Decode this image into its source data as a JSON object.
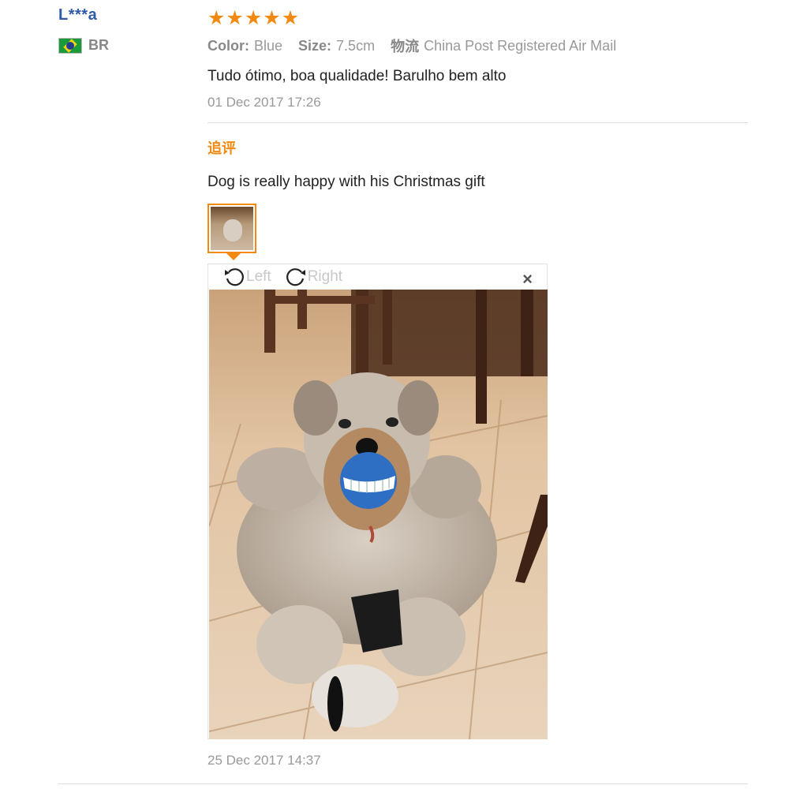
{
  "reviewer": {
    "name": "L***a",
    "country": "BR",
    "flag_icon": "brazil-flag-icon"
  },
  "review": {
    "rating": 5,
    "max_rating": 5,
    "color_label": "Color:",
    "color_value": "Blue",
    "size_label": "Size:",
    "size_value": "7.5cm",
    "shipping_label": "物流",
    "shipping_value": "China Post Registered Air Mail",
    "text": "Tudo ótimo, boa qualidade! Barulho bem alto",
    "date": "01 Dec 2017 17:26"
  },
  "followup": {
    "title": "追评",
    "text": "Dog is really happy with his Christmas gift",
    "date": "25 Dec 2017 14:37"
  },
  "viewer": {
    "rotate_left_label": "Left",
    "rotate_right_label": "Right",
    "close_label": "×"
  },
  "colors": {
    "star": "#f28a11",
    "accent": "#f08a11",
    "username": "#2f5aa6"
  }
}
